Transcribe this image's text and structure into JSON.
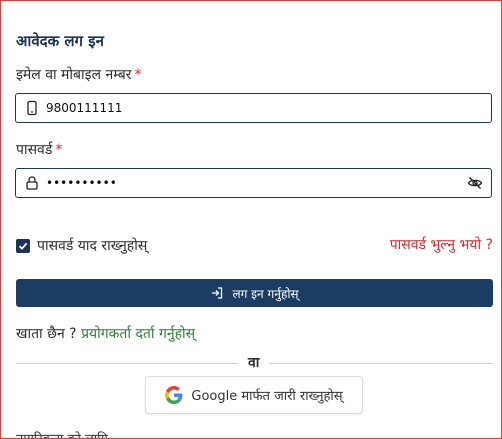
{
  "form": {
    "title": "आवेदक लग इन",
    "email_label": "इमेल वा मोबाइल नम्बर",
    "email_value": "9800111111",
    "password_label": "पासवर्ड",
    "password_value": "••••••••••",
    "required_mark": "*",
    "remember_label": "पासवर्ड याद राख्नुहोस्",
    "remember_checked": true,
    "forgot_label": "पासवर्ड भुल्नु भयो ?",
    "login_label": "लग इन गर्नुहोस्",
    "no_account_text": "खाता छैन ?",
    "register_label": "प्रयोगकर्ता दर्ता गर्नुहोस्",
    "or_text": "वा",
    "google_label": "Google मार्फत जारी राख्नुहोस्",
    "cutoff_text": "नागरिकता को लागि"
  },
  "icons": {
    "email_field": "mobile-phone-icon",
    "password_field": "lock-icon",
    "password_toggle": "eye-off-icon",
    "login": "login-arrow-icon",
    "google": "google-logo-icon"
  },
  "colors": {
    "primary": "#1c3d63",
    "danger": "#e02424",
    "success": "#2e7d32"
  }
}
